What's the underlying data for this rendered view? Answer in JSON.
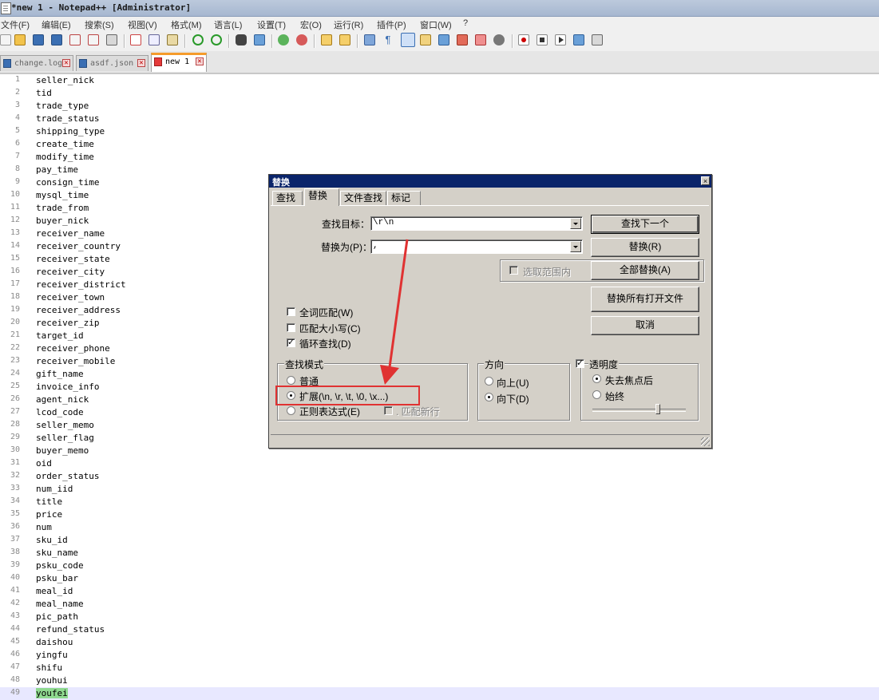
{
  "window": {
    "title": "*new 1 - Notepad++ [Administrator]"
  },
  "menu": [
    "文件(F)",
    "编辑(E)",
    "搜索(S)",
    "视图(V)",
    "格式(M)",
    "语言(L)",
    "设置(T)",
    "宏(O)",
    "运行(R)",
    "插件(P)",
    "窗口(W)",
    "?"
  ],
  "tabs": [
    {
      "label": "change.log"
    },
    {
      "label": "asdf.json"
    },
    {
      "label": "new 1"
    }
  ],
  "editor": {
    "lines": [
      "seller_nick",
      "tid",
      "trade_type",
      "trade_status",
      "shipping_type",
      "create_time",
      "modify_time",
      "pay_time",
      "consign_time",
      "mysql_time",
      "trade_from",
      "buyer_nick",
      "receiver_name",
      "receiver_country",
      "receiver_state",
      "receiver_city",
      "receiver_district",
      "receiver_town",
      "receiver_address",
      "receiver_zip",
      "target_id",
      "receiver_phone",
      "receiver_mobile",
      "gift_name",
      "invoice_info",
      "agent_nick",
      "lcod_code",
      "seller_memo",
      "seller_flag",
      "buyer_memo",
      "oid",
      "order_status",
      "num_iid",
      "title",
      "price",
      "num",
      "sku_id",
      "sku_name",
      "psku_code",
      "psku_bar",
      "meal_id",
      "meal_name",
      "pic_path",
      "refund_status",
      "daishou",
      "yingfu",
      "shifu",
      "youhui",
      "youfei"
    ],
    "current_line": 49
  },
  "dialog": {
    "title": "替换",
    "close": "×",
    "tabs": [
      "查找",
      "替换",
      "文件查找",
      "标记"
    ],
    "find_label": "查找目标：",
    "find_value": "\\r\\n",
    "replace_label": "替换为(P)：",
    "replace_value": ",",
    "in_selection": "选取范围内",
    "buttons": {
      "find_next": "查找下一个",
      "replace": "替换(R)",
      "replace_all": "全部替换(A)",
      "replace_all_open": "替换所有打开文件",
      "cancel": "取消"
    },
    "options": {
      "whole_word": "全词匹配(W)",
      "match_case": "匹配大小写(C)",
      "wrap_around": "循环查找(D)"
    },
    "search_mode": {
      "title": "查找模式",
      "normal": "普通",
      "extended": "扩展(\\n, \\r, \\t, \\0, \\x...)",
      "regex": "正则表达式(E)",
      "dot_newline": ". 匹配新行"
    },
    "direction": {
      "title": "方向",
      "up": "向上(U)",
      "down": "向下(D)"
    },
    "transparency": {
      "title": "透明度",
      "on_lose_focus": "失去焦点后",
      "always": "始终",
      "level": 0.7
    }
  },
  "annotation": {
    "color": "#e03232"
  }
}
